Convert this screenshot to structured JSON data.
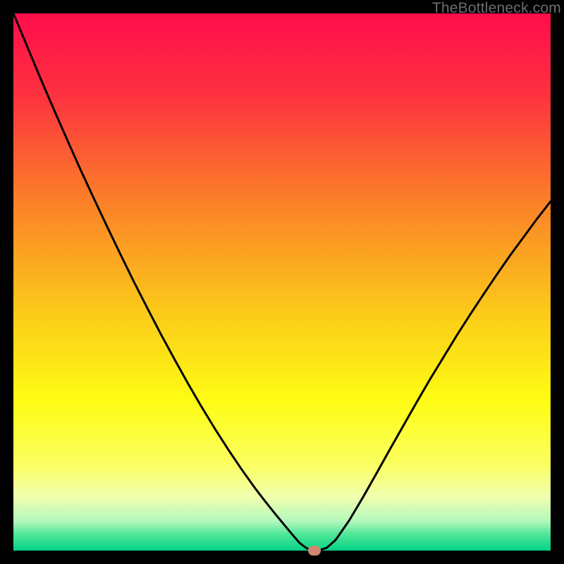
{
  "watermark": "TheBottleneck.com",
  "chart_data": {
    "type": "line",
    "title": "",
    "xlabel": "",
    "ylabel": "",
    "xlim": [
      0,
      100
    ],
    "ylim": [
      0,
      100
    ],
    "grid": false,
    "legend": false,
    "background_gradient_stops": [
      {
        "pos": 0.0,
        "color": "#ff0d4b"
      },
      {
        "pos": 0.15,
        "color": "#fd3140"
      },
      {
        "pos": 0.35,
        "color": "#fb8028"
      },
      {
        "pos": 0.55,
        "color": "#fbc81a"
      },
      {
        "pos": 0.72,
        "color": "#fefc13"
      },
      {
        "pos": 0.84,
        "color": "#fbff61"
      },
      {
        "pos": 0.9,
        "color": "#f0ffaf"
      },
      {
        "pos": 0.945,
        "color": "#b3f8bb"
      },
      {
        "pos": 0.97,
        "color": "#4de797"
      },
      {
        "pos": 1.0,
        "color": "#06d286"
      }
    ],
    "series": [
      {
        "name": "bottleneck-curve",
        "color": "#000000",
        "width": 3,
        "x": [
          0.0,
          2.5,
          5.0,
          7.5,
          10.0,
          12.5,
          15.0,
          17.5,
          20.0,
          22.5,
          25.0,
          27.5,
          30.0,
          32.5,
          35.0,
          37.5,
          40.0,
          42.5,
          45.0,
          47.0,
          49.0,
          50.5,
          52.0,
          53.3,
          54.5,
          55.5,
          56.7,
          58.3,
          60.0,
          62.5,
          65.0,
          67.5,
          70.0,
          72.5,
          75.0,
          77.5,
          80.0,
          82.5,
          85.0,
          87.5,
          90.0,
          92.5,
          95.0,
          97.5,
          100.0
        ],
        "y": [
          100.0,
          94.0,
          88.0,
          82.2,
          76.5,
          70.9,
          65.5,
          60.2,
          55.0,
          49.9,
          45.0,
          40.2,
          35.6,
          31.1,
          26.8,
          22.7,
          18.8,
          15.1,
          11.6,
          9.0,
          6.5,
          4.7,
          2.9,
          1.4,
          0.5,
          0.0,
          0.0,
          0.5,
          2.0,
          5.6,
          9.8,
          14.2,
          18.7,
          23.1,
          27.5,
          31.8,
          35.9,
          40.0,
          43.9,
          47.7,
          51.4,
          55.0,
          58.4,
          61.8,
          65.0
        ]
      }
    ],
    "marker": {
      "x": 56.1,
      "y": 0.0,
      "color": "#cf8673"
    }
  }
}
